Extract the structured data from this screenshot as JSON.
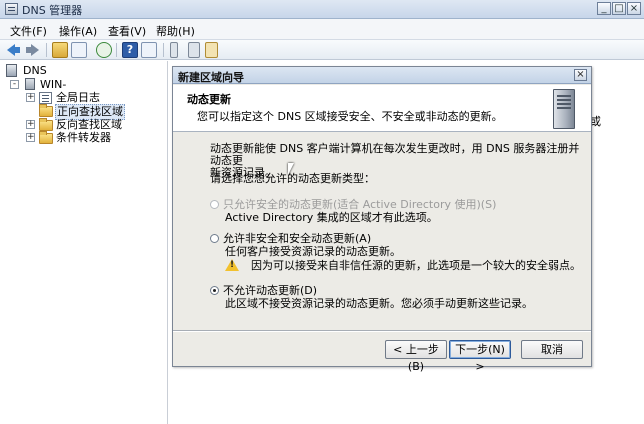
{
  "window": {
    "title": "DNS 管理器",
    "controls": {
      "minimize": "_",
      "maximize": "□",
      "close": "×"
    }
  },
  "menubar": {
    "items": [
      "文件(F)",
      "操作(A)",
      "查看(V)",
      "帮助(H)"
    ]
  },
  "toolbar": {
    "icons": [
      "back-icon",
      "forward-icon",
      "up-icon",
      "tree-icon",
      "refresh-icon",
      "help-icon",
      "properties-icon",
      "toolbar-icon-a",
      "toolbar-icon-b",
      "toolbar-icon-c"
    ],
    "help_glyph": "?"
  },
  "tree": {
    "root": "DNS",
    "server": "WIN-",
    "children": [
      {
        "label": "全局日志",
        "expander": "+"
      },
      {
        "label": "正向查找区域",
        "expander": "",
        "selected": true
      },
      {
        "label": "反向查找区域",
        "expander": "+"
      },
      {
        "label": "条件转发器",
        "expander": "+"
      }
    ],
    "server_expander": "-",
    "root_expander": ""
  },
  "right_pane": {
    "partial_text": "或"
  },
  "dialog": {
    "title": "新建区域向导",
    "close_label": "×",
    "header": {
      "title": "动态更新",
      "subtitle": "您可以指定这个 DNS 区域接受安全、不安全或非动态的更新。"
    },
    "intro_line1": "动态更新能使 DNS 客户端计算机在每次发生更改时，用 DNS 服务器注册并动态更",
    "intro_line2": "新资源记录。",
    "prompt": "请选择您想允许的动态更新类型：",
    "options": [
      {
        "label": "只允许安全的动态更新(适合 Active Directory 使用)(S)",
        "description": "Active Directory 集成的区域才有此选项。",
        "checked": false,
        "disabled": true
      },
      {
        "label": "允许非安全和安全动态更新(A)",
        "description": "任何客户接受资源记录的动态更新。",
        "warning": "因为可以接受来自非信任源的更新，此选项是一个较大的安全弱点。",
        "checked": false,
        "disabled": false
      },
      {
        "label": "不允许动态更新(D)",
        "description": "此区域不接受资源记录的动态更新。您必须手动更新这些记录。",
        "checked": true,
        "disabled": false
      }
    ],
    "buttons": {
      "back": "< 上一步(B)",
      "next": "下一步(N) >",
      "cancel": "取消"
    },
    "warning_glyph": "!"
  }
}
